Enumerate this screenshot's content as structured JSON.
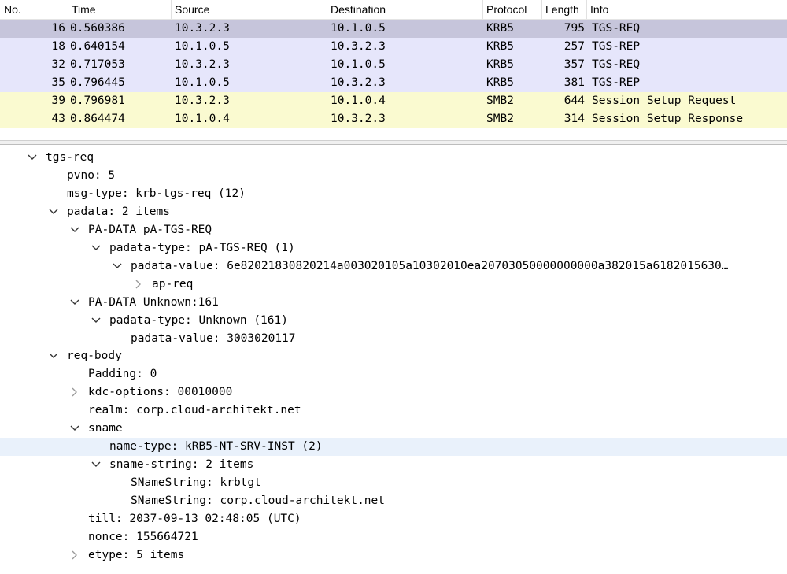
{
  "colors": {
    "krb_selected": "#c6c5db",
    "krb_row": "#e6e6fb",
    "smb_row": "#fafad0",
    "detail_highlight": "#e9f1fb"
  },
  "packet_list": {
    "columns": [
      "No.",
      "Time",
      "Source",
      "Destination",
      "Protocol",
      "Length",
      "Info"
    ],
    "rows": [
      {
        "no": "16",
        "time": "0.560386",
        "src": "10.3.2.3",
        "dst": "10.1.0.5",
        "proto": "KRB5",
        "len": "795",
        "info": "TGS-REQ",
        "kind": "selected"
      },
      {
        "no": "18",
        "time": "0.640154",
        "src": "10.1.0.5",
        "dst": "10.3.2.3",
        "proto": "KRB5",
        "len": "257",
        "info": "TGS-REP",
        "kind": "krb"
      },
      {
        "no": "32",
        "time": "0.717053",
        "src": "10.3.2.3",
        "dst": "10.1.0.5",
        "proto": "KRB5",
        "len": "357",
        "info": "TGS-REQ",
        "kind": "krb"
      },
      {
        "no": "35",
        "time": "0.796445",
        "src": "10.1.0.5",
        "dst": "10.3.2.3",
        "proto": "KRB5",
        "len": "381",
        "info": "TGS-REP",
        "kind": "krb"
      },
      {
        "no": "39",
        "time": "0.796981",
        "src": "10.3.2.3",
        "dst": "10.1.0.4",
        "proto": "SMB2",
        "len": "644",
        "info": "Session Setup Request",
        "kind": "smb"
      },
      {
        "no": "43",
        "time": "0.864474",
        "src": "10.1.0.4",
        "dst": "10.3.2.3",
        "proto": "SMB2",
        "len": "314",
        "info": "Session Setup Response",
        "kind": "smb"
      }
    ]
  },
  "detail_tree": [
    {
      "depth": 0,
      "state": "expanded",
      "text": "tgs-req"
    },
    {
      "depth": 1,
      "state": "leaf",
      "text": "pvno: 5"
    },
    {
      "depth": 1,
      "state": "leaf",
      "text": "msg-type: krb-tgs-req (12)"
    },
    {
      "depth": 1,
      "state": "expanded",
      "text": "padata: 2 items"
    },
    {
      "depth": 2,
      "state": "expanded",
      "text": "PA-DATA pA-TGS-REQ"
    },
    {
      "depth": 3,
      "state": "expanded",
      "text": "padata-type: pA-TGS-REQ (1)"
    },
    {
      "depth": 4,
      "state": "expanded",
      "text": "padata-value: 6e82021830820214a003020105a10302010ea20703050000000000a382015a6182015630…"
    },
    {
      "depth": 5,
      "state": "collapsed",
      "text": "ap-req"
    },
    {
      "depth": 2,
      "state": "expanded",
      "text": "PA-DATA Unknown:161"
    },
    {
      "depth": 3,
      "state": "expanded",
      "text": "padata-type: Unknown (161)"
    },
    {
      "depth": 4,
      "state": "leaf",
      "text": "padata-value: 3003020117"
    },
    {
      "depth": 1,
      "state": "expanded",
      "text": "req-body"
    },
    {
      "depth": 2,
      "state": "leaf",
      "text": "Padding: 0"
    },
    {
      "depth": 2,
      "state": "collapsed",
      "text": "kdc-options: 00010000"
    },
    {
      "depth": 2,
      "state": "leaf",
      "text": "realm: corp.cloud-architekt.net"
    },
    {
      "depth": 2,
      "state": "expanded",
      "text": "sname"
    },
    {
      "depth": 3,
      "state": "leaf",
      "text": "name-type: kRB5-NT-SRV-INST (2)",
      "highlighted": true
    },
    {
      "depth": 3,
      "state": "expanded",
      "text": "sname-string: 2 items"
    },
    {
      "depth": 4,
      "state": "leaf",
      "text": "SNameString: krbtgt"
    },
    {
      "depth": 4,
      "state": "leaf",
      "text": "SNameString: corp.cloud-architekt.net"
    },
    {
      "depth": 2,
      "state": "leaf",
      "text": "till: 2037-09-13 02:48:05 (UTC)"
    },
    {
      "depth": 2,
      "state": "leaf",
      "text": "nonce: 155664721"
    },
    {
      "depth": 2,
      "state": "collapsed",
      "text": "etype: 5 items"
    }
  ]
}
